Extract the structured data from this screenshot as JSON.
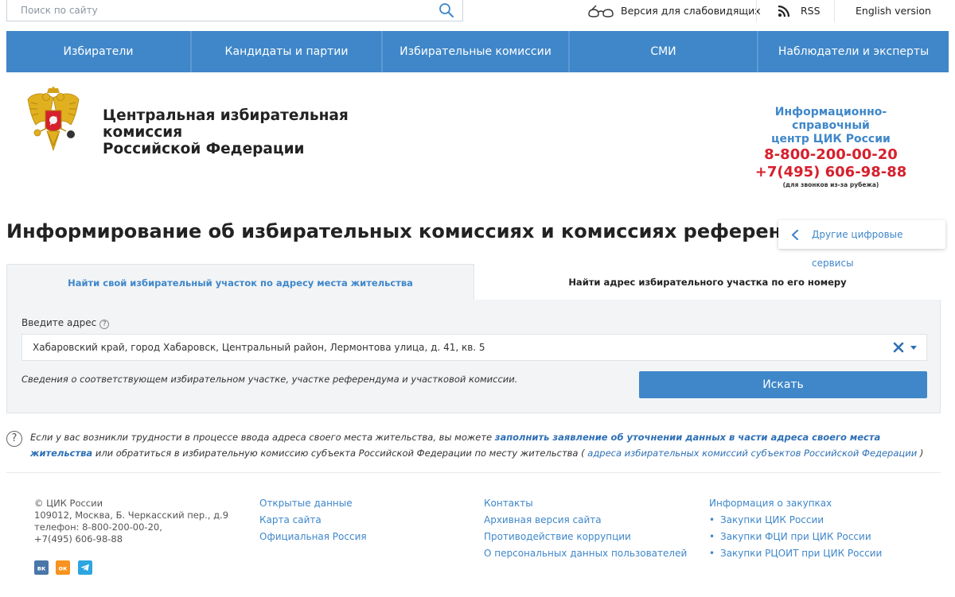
{
  "top": {
    "search_placeholder": "Поиск по сайту",
    "low_vision": "Версия для слабовидящих",
    "rss": "RSS",
    "english": "English version"
  },
  "nav": {
    "items": [
      "Избиратели",
      "Кандидаты и партии",
      "Избирательные комиссии",
      "СМИ",
      "Наблюдатели и эксперты"
    ]
  },
  "header": {
    "org_line1": "Центральная избирательная комиссия",
    "org_line2": "Российской Федерации",
    "info_title_line1": "Информационно-справочный",
    "info_title_line2": "центр ЦИК России",
    "phone1": "8-800-200-00-20",
    "phone2": "+7(495) 606-98-88",
    "phone_note": "(для звонков из-за рубежа)"
  },
  "page": {
    "title": "Информирование об избирательных комиссиях и комиссиях референдума",
    "other_services": "Другие цифровые сервисы"
  },
  "tabs": {
    "active": "Найти свой избирательный участок по адресу места жительства",
    "inactive": "Найти адрес избирательного участка по его номеру"
  },
  "form": {
    "label": "Введите адрес",
    "help_glyph": "?",
    "address_value": "Хабаровский край, город Хабаровск, Центральный район, Лермонтова улица, д. 41, кв. 5",
    "note": "Сведения о соответствующем избирательном участке, участке референдума и участковой комиссии.",
    "search_button": "Искать"
  },
  "help": {
    "glyph": "?",
    "text1": "Если у вас возникли трудности в процессе ввода адреса своего места жительства, вы можете ",
    "link1": "заполнить заявление об уточнении данных в части адреса своего места жительства",
    "text2": " или обратиться в избирательную комиссию субъекта Российской Федерации по месту жительства ( ",
    "link2": "адреса избирательных комиссий субъектов Российской Федерации",
    "text3": " )"
  },
  "footer": {
    "copyright": "© ЦИК России",
    "address": "109012, Москва, Б. Черкасский пер., д.9",
    "phone": "телефон: 8-800-200-00-20,",
    "phone2": "+7(495) 606-98-88",
    "col2": [
      "Открытые данные",
      "Карта сайта",
      "Официальная Россия"
    ],
    "col3": [
      "Контакты",
      "Архивная версия сайта",
      "Противодействие коррупции",
      "О персональных данных пользователей"
    ],
    "col4_title": "Информация о закупках",
    "col4": [
      "Закупки ЦИК России",
      "Закупки ФЦИ при ЦИК России",
      "Закупки РЦОИТ при ЦИК России"
    ],
    "social": {
      "vk": "вк",
      "ok": "ок"
    }
  },
  "colors": {
    "brand_blue": "#3f87c9",
    "phone_red": "#d6202d",
    "panel_bg": "#f2f4f6"
  }
}
